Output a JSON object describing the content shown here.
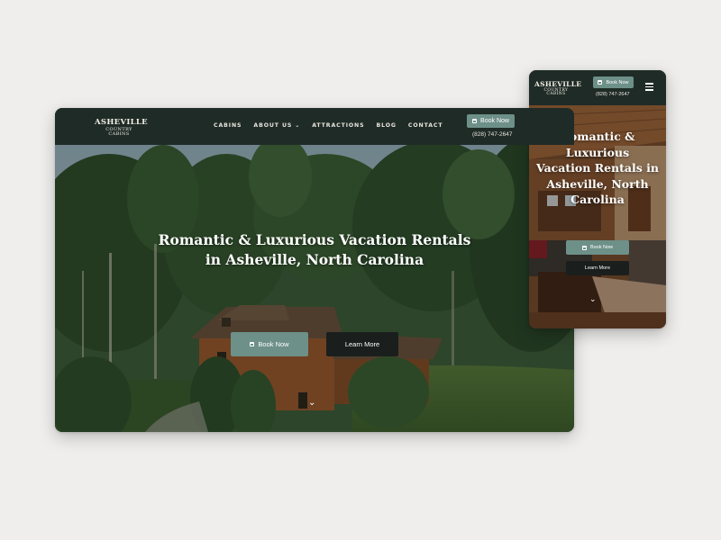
{
  "desktop": {
    "logo": {
      "line1": "ASHEVILLE",
      "line2": "COUNTRY CABINS"
    },
    "nav": [
      {
        "label": "CABINS",
        "has_dropdown": false
      },
      {
        "label": "ABOUT US",
        "has_dropdown": true
      },
      {
        "label": "ATTRACTIONS",
        "has_dropdown": false
      },
      {
        "label": "BLOG",
        "has_dropdown": false
      },
      {
        "label": "CONTACT",
        "has_dropdown": false
      }
    ],
    "dropdown_icon": "chevron-down-icon",
    "header_book_label": "Book Now",
    "phone": "(828) 747-2647",
    "hero": {
      "title_line1": "Romantic & Luxurious Vacation Rentals",
      "title_line2": "in Asheville, North Carolina",
      "book_label": "Book Now",
      "learn_label": "Learn More",
      "scroll_icon": "chevron-down-icon"
    }
  },
  "mobile": {
    "logo": {
      "line1": "ASHEVILLE",
      "line2": "COUNTRY CABINS"
    },
    "header_book_label": "Book Now",
    "phone": "(828) 747-2647",
    "menu_icon": "hamburger-icon",
    "hero": {
      "title_line1": "Romantic &",
      "title_line2": "Luxurious",
      "title_line3": "Vacation Rentals in",
      "title_line4": "Asheville, North",
      "title_line5": "Carolina",
      "book_label": "Book Now",
      "learn_label": "Learn More",
      "scroll_icon": "chevron-down-icon"
    }
  },
  "colors": {
    "background": "#efeeec",
    "header": "#1f2b27",
    "accent": "#6d9088",
    "dark_button": "#1a1f1d",
    "text_light": "#ffffff"
  },
  "icons": {
    "calendar": "calendar-icon"
  }
}
